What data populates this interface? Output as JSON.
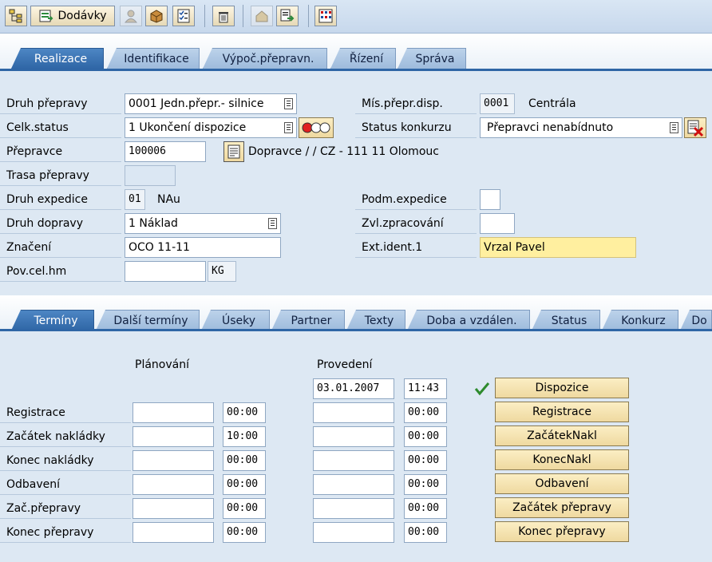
{
  "toolbar": {
    "dodavky_label": "Dodávky"
  },
  "tabs_top": [
    "Realizace",
    "Identifikace",
    "Výpoč.přepravn.",
    "Řízení",
    "Správa"
  ],
  "header": {
    "druh_prepravy": {
      "label": "Druh přepravy",
      "value": "0001 Jedn.přepr.- silnice"
    },
    "celk_status": {
      "label": "Celk.status",
      "value": "1 Ukončení dispozice"
    },
    "prepravce": {
      "label": "Přepravce",
      "value": "100006",
      "desc": "Dopravce /  / CZ - 111 11 Olomouc"
    },
    "trasa": {
      "label": "Trasa přepravy",
      "value": ""
    },
    "druh_expedice": {
      "label": "Druh expedice",
      "value": "01",
      "desc": "NAu"
    },
    "druh_dopravy": {
      "label": "Druh dopravy",
      "value": "1 Náklad"
    },
    "znaceni": {
      "label": "Značení",
      "value": "OCO 11-11"
    },
    "pov_cel_hm": {
      "label": "Pov.cel.hm",
      "value": "",
      "unit": "KG"
    },
    "mis_prepr_disp": {
      "label": "Mís.přepr.disp.",
      "value": "0001",
      "desc": "Centrála"
    },
    "status_konkurzu": {
      "label": "Status konkurzu",
      "value": "Přepravci nenabídnuto"
    },
    "podm_expedice": {
      "label": "Podm.expedice",
      "value": ""
    },
    "zvl_zpracovani": {
      "label": "Zvl.zpracování",
      "value": ""
    },
    "ext_ident": {
      "label": "Ext.ident.1",
      "value": "Vrzal Pavel"
    }
  },
  "tabs_bottom": [
    "Termíny",
    "Další termíny",
    "Úseky",
    "Partner",
    "Texty",
    "Doba a vzdálen.",
    "Status",
    "Konkurz",
    "Do"
  ],
  "terminy": {
    "col_planovani": "Plánování",
    "col_provedeni": "Provedení",
    "top_row": {
      "date": "03.01.2007",
      "time": "11:43",
      "button": "Dispozice"
    },
    "rows": [
      {
        "label": "Registrace",
        "plan_date": "",
        "plan_time": "00:00",
        "exec_date": "",
        "exec_time": "00:00",
        "button": "Registrace"
      },
      {
        "label": "Začátek nakládky",
        "plan_date": "",
        "plan_time": "10:00",
        "exec_date": "",
        "exec_time": "00:00",
        "button": "ZačátekNakl"
      },
      {
        "label": "Konec nakládky",
        "plan_date": "",
        "plan_time": "00:00",
        "exec_date": "",
        "exec_time": "00:00",
        "button": "KonecNakl"
      },
      {
        "label": "Odbavení",
        "plan_date": "",
        "plan_time": "00:00",
        "exec_date": "",
        "exec_time": "00:00",
        "button": "Odbavení"
      },
      {
        "label": "Zač.přepravy",
        "plan_date": "",
        "plan_time": "00:00",
        "exec_date": "",
        "exec_time": "00:00",
        "button": "Začátek přepravy"
      },
      {
        "label": "Konec přepravy",
        "plan_date": "",
        "plan_time": "00:00",
        "exec_date": "",
        "exec_time": "00:00",
        "button": "Konec přepravy"
      }
    ]
  }
}
